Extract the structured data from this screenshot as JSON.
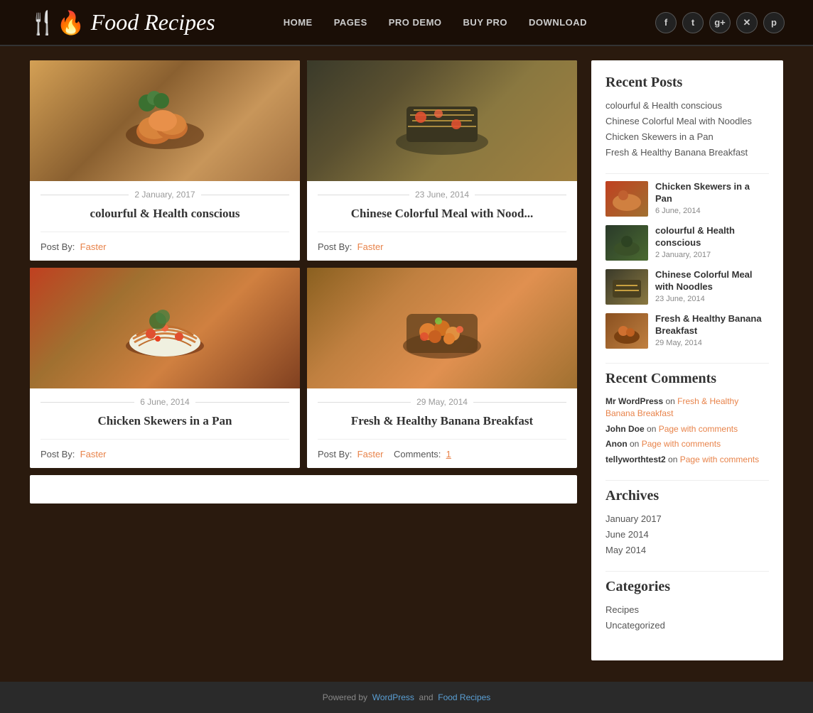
{
  "site": {
    "logo_text": "Food",
    "logo_text2": "Recipes",
    "logo_icon": "🍽"
  },
  "nav": {
    "items": [
      {
        "label": "HOME",
        "href": "#"
      },
      {
        "label": "PAGES",
        "href": "#"
      },
      {
        "label": "PRO DEMO",
        "href": "#"
      },
      {
        "label": "BUY PRO",
        "href": "#"
      },
      {
        "label": "DOWNLOAD",
        "href": "#"
      }
    ]
  },
  "social": {
    "buttons": [
      {
        "label": "f",
        "name": "facebook"
      },
      {
        "label": "t",
        "name": "twitter"
      },
      {
        "label": "g+",
        "name": "google-plus"
      },
      {
        "label": "✕",
        "name": "close"
      },
      {
        "label": "p",
        "name": "pinterest"
      }
    ]
  },
  "posts": [
    {
      "id": 1,
      "date": "2 January, 2017",
      "title": "colourful & Health conscious",
      "author": "Faster",
      "comments": null,
      "img_class": "food-img-1"
    },
    {
      "id": 2,
      "date": "23 June, 2014",
      "title": "Chinese Colorful Meal with Nood...",
      "author": "Faster",
      "comments": null,
      "img_class": "food-img-2"
    },
    {
      "id": 3,
      "date": "6 June, 2014",
      "title": "Chicken Skewers in a Pan",
      "author": "Faster",
      "comments": null,
      "img_class": "food-img-3"
    },
    {
      "id": 4,
      "date": "29 May, 2014",
      "title": "Fresh & Healthy Banana Breakfast",
      "author": "Faster",
      "comments": "1",
      "img_class": "food-img-4"
    }
  ],
  "sidebar": {
    "recent_posts_title": "Recent Posts",
    "recent_links": [
      "colourful & Health conscious",
      "Chinese Colorful Meal with Noodles",
      "Chicken Skewers in a Pan",
      "Fresh & Healthy Banana Breakfast"
    ],
    "recent_post_items": [
      {
        "title": "Chicken Skewers in a Pan",
        "date": "6 June, 2014",
        "thumb_class": "thumb-1"
      },
      {
        "title": "colourful & Health conscious",
        "date": "2 January, 2017",
        "thumb_class": "thumb-2"
      },
      {
        "title": "Chinese Colorful Meal with Noodles",
        "date": "23 June, 2014",
        "thumb_class": "thumb-3"
      },
      {
        "title": "Fresh & Healthy Banana Breakfast",
        "date": "29 May, 2014",
        "thumb_class": "thumb-4"
      }
    ],
    "recent_comments_title": "Recent Comments",
    "comments": [
      {
        "author": "Mr WordPress",
        "action": "on",
        "link": "Fresh & Healthy Banana Breakfast"
      },
      {
        "author": "John Doe",
        "action": "on",
        "link": "Page with comments"
      },
      {
        "author": "Anon",
        "action": "on",
        "link": "Page with comments"
      },
      {
        "author": "tellyworthtest2",
        "action": "on",
        "link": "Page with comments"
      }
    ],
    "archives_title": "Archives",
    "archives": [
      "January 2017",
      "June 2014",
      "May 2014"
    ],
    "categories_title": "Categories",
    "categories": [
      "Recipes",
      "Uncategorized"
    ]
  },
  "footer": {
    "text": "Powered by",
    "wp_text": "WordPress",
    "and_text": "and",
    "theme_text": "Food Recipes"
  },
  "labels": {
    "post_by": "Post By:",
    "comments_label": "Comments:"
  }
}
